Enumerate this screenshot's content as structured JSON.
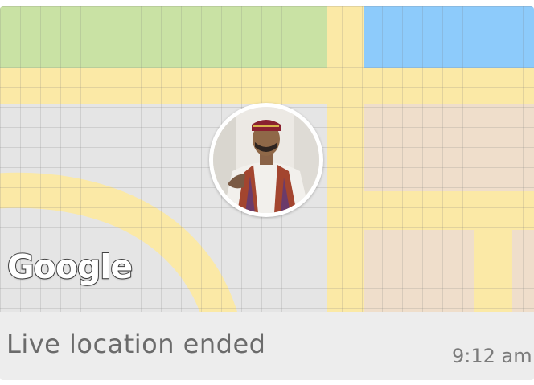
{
  "message": {
    "map": {
      "logo_text": "Google",
      "colors": {
        "park": "#c9e2a4",
        "water": "#8dcbfb",
        "road": "#fbe9a6",
        "building": "#efdecb",
        "land": "#e5e5e5"
      }
    },
    "avatar": {
      "icon": "user-avatar"
    },
    "status_text": "Live location ended",
    "time": "9:12 am"
  }
}
